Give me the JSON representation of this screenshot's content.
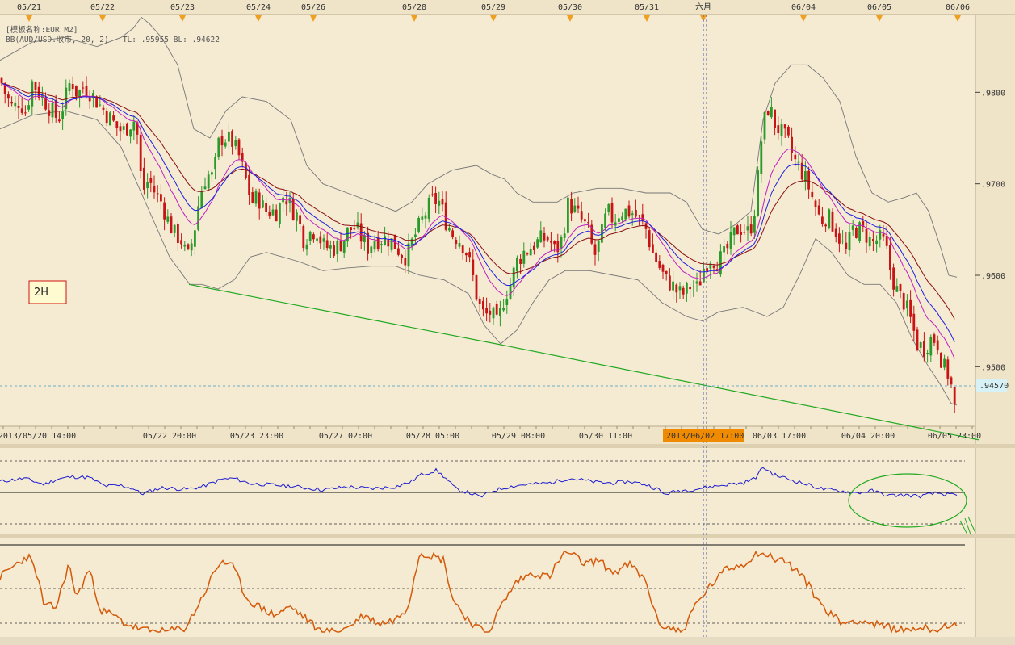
{
  "top_dates": [
    "05/21",
    "05/22",
    "05/23",
    "05/24",
    "05/26",
    "05/28",
    "05/29",
    "05/30",
    "05/31",
    "六月",
    "06/04",
    "06/05",
    "06/06"
  ],
  "info": {
    "board": "[模板名称:EUR M2]",
    "indicator": "BB(AUD/USD.收市, 20, 2) -  TL: .95955  BL: .94622"
  },
  "timeframe_label": "2H",
  "bottom_dates": [
    "2013/05/20 14:00",
    "05/22 20:00",
    "05/23 23:00",
    "05/27 02:00",
    "05/28 05:00",
    "05/29 08:00",
    "05/30 11:00",
    "2013/06/02 17:00",
    "06/03 17:00",
    "06/04 20:00",
    "06/05 23:00"
  ],
  "highlight_date": "2013/06/02 17:00",
  "current_price_label": ".94570",
  "chart_data": {
    "type": "candlestick",
    "symbol": "AUD/USD",
    "interval": "2H",
    "price_axis": {
      "ticks": [
        ".9800",
        ".9700",
        ".9600",
        ".9500"
      ],
      "values": [
        0.98,
        0.97,
        0.96,
        0.95
      ],
      "ylim": [
        0.9435,
        0.9885
      ]
    },
    "current_price": 0.9457,
    "bollinger": {
      "period": 20,
      "stddev": 2,
      "upper_last": 0.95955,
      "lower_last": 0.94622
    },
    "close_path": [
      [
        0,
        0.9815
      ],
      [
        8,
        0.9795
      ],
      [
        16,
        0.9782
      ],
      [
        24,
        0.9791
      ],
      [
        32,
        0.9778
      ],
      [
        40,
        0.9812
      ],
      [
        48,
        0.98
      ],
      [
        56,
        0.979
      ],
      [
        64,
        0.978
      ],
      [
        72,
        0.977
      ],
      [
        80,
        0.979
      ],
      [
        88,
        0.9815
      ],
      [
        96,
        0.9797
      ],
      [
        104,
        0.9807
      ],
      [
        112,
        0.98
      ],
      [
        120,
        0.979
      ],
      [
        128,
        0.9781
      ],
      [
        136,
        0.9772
      ],
      [
        144,
        0.9762
      ],
      [
        152,
        0.9757
      ],
      [
        160,
        0.9765
      ],
      [
        168,
        0.9771
      ],
      [
        172,
        0.9735
      ],
      [
        176,
        0.969
      ],
      [
        184,
        0.9705
      ],
      [
        192,
        0.969
      ],
      [
        200,
        0.968
      ],
      [
        208,
        0.966
      ],
      [
        216,
        0.9645
      ],
      [
        224,
        0.964
      ],
      [
        232,
        0.9617
      ],
      [
        240,
        0.9645
      ],
      [
        248,
        0.969
      ],
      [
        256,
        0.971
      ],
      [
        264,
        0.9707
      ],
      [
        272,
        0.975
      ],
      [
        280,
        0.975
      ],
      [
        288,
        0.9745
      ],
      [
        296,
        0.973
      ],
      [
        304,
        0.9705
      ],
      [
        312,
        0.968
      ],
      [
        320,
        0.9685
      ],
      [
        328,
        0.967
      ],
      [
        336,
        0.967
      ],
      [
        344,
        0.967
      ],
      [
        352,
        0.969
      ],
      [
        360,
        0.9675
      ],
      [
        368,
        0.9665
      ],
      [
        376,
        0.964
      ],
      [
        384,
        0.9647
      ],
      [
        392,
        0.965
      ],
      [
        400,
        0.9632
      ],
      [
        408,
        0.963
      ],
      [
        416,
        0.963
      ],
      [
        424,
        0.9637
      ],
      [
        432,
        0.965
      ],
      [
        440,
        0.9652
      ],
      [
        448,
        0.964
      ],
      [
        456,
        0.963
      ],
      [
        464,
        0.964
      ],
      [
        472,
        0.964
      ],
      [
        480,
        0.964
      ],
      [
        488,
        0.9635
      ],
      [
        496,
        0.9625
      ],
      [
        504,
        0.962
      ],
      [
        512,
        0.964
      ],
      [
        520,
        0.9655
      ],
      [
        528,
        0.967
      ],
      [
        536,
        0.9682
      ],
      [
        544,
        0.968
      ],
      [
        552,
        0.966
      ],
      [
        560,
        0.9645
      ],
      [
        568,
        0.964
      ],
      [
        576,
        0.963
      ],
      [
        584,
        0.9605
      ],
      [
        592,
        0.957
      ],
      [
        600,
        0.9555
      ],
      [
        608,
        0.956
      ],
      [
        616,
        0.9545
      ],
      [
        624,
        0.9575
      ],
      [
        632,
        0.959
      ],
      [
        640,
        0.9615
      ],
      [
        648,
        0.9625
      ],
      [
        656,
        0.963
      ],
      [
        664,
        0.9635
      ],
      [
        672,
        0.964
      ],
      [
        680,
        0.964
      ],
      [
        688,
        0.9625
      ],
      [
        696,
        0.964
      ],
      [
        704,
        0.968
      ],
      [
        712,
        0.967
      ],
      [
        720,
        0.966
      ],
      [
        728,
        0.965
      ],
      [
        736,
        0.962
      ],
      [
        744,
        0.964
      ],
      [
        752,
        0.967
      ],
      [
        760,
        0.966
      ],
      [
        768,
        0.967
      ],
      [
        776,
        0.967
      ],
      [
        784,
        0.9668
      ],
      [
        792,
        0.966
      ],
      [
        800,
        0.965
      ],
      [
        808,
        0.9625
      ],
      [
        816,
        0.961
      ],
      [
        824,
        0.9595
      ],
      [
        832,
        0.959
      ],
      [
        840,
        0.958
      ],
      [
        848,
        0.958
      ],
      [
        856,
        0.959
      ],
      [
        864,
        0.9585
      ],
      [
        872,
        0.961
      ],
      [
        880,
        0.962
      ],
      [
        888,
        0.9615
      ],
      [
        896,
        0.962
      ],
      [
        904,
        0.9635
      ],
      [
        912,
        0.965
      ],
      [
        920,
        0.9652
      ],
      [
        928,
        0.9645
      ],
      [
        936,
        0.968
      ],
      [
        944,
        0.976
      ],
      [
        952,
        0.9785
      ],
      [
        960,
        0.9765
      ],
      [
        968,
        0.9755
      ],
      [
        976,
        0.9745
      ],
      [
        984,
        0.9725
      ],
      [
        992,
        0.9715
      ],
      [
        1000,
        0.97
      ],
      [
        1008,
        0.968
      ],
      [
        1016,
        0.966
      ],
      [
        1024,
        0.9665
      ],
      [
        1032,
        0.9655
      ],
      [
        1040,
        0.964
      ],
      [
        1048,
        0.9625
      ],
      [
        1056,
        0.965
      ],
      [
        1064,
        0.965
      ],
      [
        1072,
        0.9645
      ],
      [
        1080,
        0.9635
      ],
      [
        1088,
        0.964
      ],
      [
        1096,
        0.9635
      ],
      [
        1104,
        0.96
      ],
      [
        1112,
        0.958
      ],
      [
        1120,
        0.957
      ],
      [
        1128,
        0.955
      ],
      [
        1136,
        0.9525
      ],
      [
        1144,
        0.952
      ],
      [
        1152,
        0.953
      ],
      [
        1160,
        0.953
      ],
      [
        1168,
        0.95
      ],
      [
        1176,
        0.949
      ],
      [
        1182,
        0.9455
      ]
    ],
    "bb_upper_path": [
      [
        0,
        0.9835
      ],
      [
        40,
        0.9855
      ],
      [
        80,
        0.986
      ],
      [
        120,
        0.985
      ],
      [
        150,
        0.986
      ],
      [
        165,
        0.987
      ],
      [
        175,
        0.9882
      ],
      [
        185,
        0.9875
      ],
      [
        200,
        0.986
      ],
      [
        220,
        0.983
      ],
      [
        240,
        0.976
      ],
      [
        260,
        0.975
      ],
      [
        280,
        0.978
      ],
      [
        300,
        0.9795
      ],
      [
        330,
        0.979
      ],
      [
        360,
        0.977
      ],
      [
        380,
        0.972
      ],
      [
        400,
        0.97
      ],
      [
        430,
        0.969
      ],
      [
        460,
        0.968
      ],
      [
        490,
        0.967
      ],
      [
        510,
        0.968
      ],
      [
        530,
        0.97
      ],
      [
        560,
        0.9715
      ],
      [
        590,
        0.972
      ],
      [
        610,
        0.971
      ],
      [
        625,
        0.9705
      ],
      [
        640,
        0.969
      ],
      [
        660,
        0.968
      ],
      [
        690,
        0.968
      ],
      [
        710,
        0.969
      ],
      [
        740,
        0.9695
      ],
      [
        770,
        0.9695
      ],
      [
        800,
        0.969
      ],
      [
        830,
        0.969
      ],
      [
        850,
        0.968
      ],
      [
        870,
        0.965
      ],
      [
        890,
        0.9645
      ],
      [
        910,
        0.9655
      ],
      [
        930,
        0.967
      ],
      [
        945,
        0.977
      ],
      [
        960,
        0.981
      ],
      [
        980,
        0.983
      ],
      [
        1000,
        0.983
      ],
      [
        1020,
        0.9815
      ],
      [
        1040,
        0.979
      ],
      [
        1060,
        0.973
      ],
      [
        1080,
        0.969
      ],
      [
        1100,
        0.968
      ],
      [
        1120,
        0.9685
      ],
      [
        1135,
        0.969
      ],
      [
        1150,
        0.967
      ],
      [
        1165,
        0.963
      ],
      [
        1175,
        0.96
      ],
      [
        1185,
        0.9598
      ]
    ],
    "bb_lower_path": [
      [
        0,
        0.976
      ],
      [
        40,
        0.9775
      ],
      [
        80,
        0.978
      ],
      [
        120,
        0.977
      ],
      [
        150,
        0.974
      ],
      [
        170,
        0.97
      ],
      [
        190,
        0.966
      ],
      [
        210,
        0.962
      ],
      [
        235,
        0.959
      ],
      [
        250,
        0.959
      ],
      [
        270,
        0.9585
      ],
      [
        290,
        0.9595
      ],
      [
        310,
        0.962
      ],
      [
        330,
        0.9625
      ],
      [
        350,
        0.962
      ],
      [
        370,
        0.9615
      ],
      [
        400,
        0.9605
      ],
      [
        430,
        0.9608
      ],
      [
        460,
        0.961
      ],
      [
        490,
        0.961
      ],
      [
        520,
        0.96
      ],
      [
        550,
        0.9595
      ],
      [
        580,
        0.958
      ],
      [
        600,
        0.9545
      ],
      [
        620,
        0.9525
      ],
      [
        640,
        0.954
      ],
      [
        660,
        0.957
      ],
      [
        680,
        0.9595
      ],
      [
        700,
        0.9605
      ],
      [
        730,
        0.9605
      ],
      [
        760,
        0.96
      ],
      [
        790,
        0.9595
      ],
      [
        820,
        0.957
      ],
      [
        850,
        0.9555
      ],
      [
        870,
        0.955
      ],
      [
        890,
        0.956
      ],
      [
        920,
        0.9565
      ],
      [
        950,
        0.9555
      ],
      [
        970,
        0.9565
      ],
      [
        990,
        0.96
      ],
      [
        1010,
        0.964
      ],
      [
        1030,
        0.9625
      ],
      [
        1050,
        0.96
      ],
      [
        1070,
        0.959
      ],
      [
        1090,
        0.959
      ],
      [
        1110,
        0.957
      ],
      [
        1130,
        0.953
      ],
      [
        1150,
        0.95
      ],
      [
        1165,
        0.948
      ],
      [
        1178,
        0.946
      ],
      [
        1185,
        0.9458
      ]
    ],
    "trendline": [
      [
        234,
        0.959
      ],
      [
        615,
        0.9525
      ],
      [
        1213,
        0.942
      ]
    ],
    "rsi_path": [
      [
        0,
        0.35
      ],
      [
        30,
        0.45
      ],
      [
        55,
        0.25
      ],
      [
        70,
        0.42
      ],
      [
        90,
        0.5
      ],
      [
        110,
        0.48
      ],
      [
        130,
        0.2
      ],
      [
        150,
        0.22
      ],
      [
        165,
        0.12
      ],
      [
        175,
        -0.05
      ],
      [
        200,
        0.15
      ],
      [
        230,
        0.1
      ],
      [
        250,
        0.18
      ],
      [
        275,
        0.42
      ],
      [
        290,
        0.45
      ],
      [
        310,
        0.28
      ],
      [
        330,
        0.25
      ],
      [
        360,
        0.2
      ],
      [
        400,
        0.08
      ],
      [
        430,
        0.18
      ],
      [
        460,
        0.12
      ],
      [
        490,
        0.18
      ],
      [
        510,
        0.35
      ],
      [
        520,
        0.55
      ],
      [
        540,
        0.7
      ],
      [
        550,
        0.5
      ],
      [
        565,
        0.1
      ],
      [
        580,
        0.0
      ],
      [
        595,
        -0.15
      ],
      [
        610,
        0.05
      ],
      [
        630,
        0.18
      ],
      [
        650,
        0.25
      ],
      [
        680,
        0.3
      ],
      [
        705,
        0.45
      ],
      [
        720,
        0.4
      ],
      [
        740,
        0.32
      ],
      [
        760,
        0.3
      ],
      [
        780,
        0.35
      ],
      [
        800,
        0.25
      ],
      [
        815,
        0.1
      ],
      [
        822,
        -0.06
      ],
      [
        840,
        0.05
      ],
      [
        860,
        0.1
      ],
      [
        880,
        0.18
      ],
      [
        900,
        0.25
      ],
      [
        920,
        0.3
      ],
      [
        935,
        0.45
      ],
      [
        945,
        0.8
      ],
      [
        960,
        0.55
      ],
      [
        980,
        0.4
      ],
      [
        1000,
        0.25
      ],
      [
        1020,
        0.1
      ],
      [
        1040,
        0.05
      ],
      [
        1060,
        -0.02
      ],
      [
        1080,
        0.05
      ],
      [
        1100,
        -0.1
      ],
      [
        1120,
        -0.08
      ],
      [
        1140,
        -0.12
      ],
      [
        1160,
        -0.02
      ],
      [
        1175,
        -0.08
      ],
      [
        1185,
        -0.1
      ]
    ],
    "stoch_path": [
      [
        0,
        0.65
      ],
      [
        20,
        0.8
      ],
      [
        35,
        0.9
      ],
      [
        45,
        0.7
      ],
      [
        55,
        0.3
      ],
      [
        70,
        0.3
      ],
      [
        85,
        0.8
      ],
      [
        95,
        0.4
      ],
      [
        110,
        0.75
      ],
      [
        125,
        0.25
      ],
      [
        140,
        0.2
      ],
      [
        155,
        0.1
      ],
      [
        170,
        0.05
      ],
      [
        180,
        0.02
      ],
      [
        200,
        0.0
      ],
      [
        215,
        0.02
      ],
      [
        230,
        0.05
      ],
      [
        250,
        0.4
      ],
      [
        265,
        0.7
      ],
      [
        275,
        0.85
      ],
      [
        290,
        0.75
      ],
      [
        305,
        0.4
      ],
      [
        320,
        0.3
      ],
      [
        340,
        0.2
      ],
      [
        360,
        0.3
      ],
      [
        380,
        0.15
      ],
      [
        395,
        0.02
      ],
      [
        410,
        0.0
      ],
      [
        430,
        0.05
      ],
      [
        450,
        0.2
      ],
      [
        470,
        0.1
      ],
      [
        490,
        0.15
      ],
      [
        505,
        0.3
      ],
      [
        520,
        0.95
      ],
      [
        535,
        0.9
      ],
      [
        550,
        0.85
      ],
      [
        560,
        0.4
      ],
      [
        575,
        0.2
      ],
      [
        590,
        0.05
      ],
      [
        605,
        0.0
      ],
      [
        620,
        0.3
      ],
      [
        640,
        0.6
      ],
      [
        660,
        0.7
      ],
      [
        680,
        0.65
      ],
      [
        700,
        0.95
      ],
      [
        710,
        0.9
      ],
      [
        725,
        0.8
      ],
      [
        740,
        0.85
      ],
      [
        760,
        0.7
      ],
      [
        780,
        0.8
      ],
      [
        800,
        0.6
      ],
      [
        815,
        0.1
      ],
      [
        830,
        0.05
      ],
      [
        845,
        0.0
      ],
      [
        860,
        0.3
      ],
      [
        880,
        0.55
      ],
      [
        900,
        0.75
      ],
      [
        920,
        0.8
      ],
      [
        940,
        0.95
      ],
      [
        955,
        0.88
      ],
      [
        970,
        0.85
      ],
      [
        990,
        0.7
      ],
      [
        1005,
        0.5
      ],
      [
        1015,
        0.35
      ],
      [
        1030,
        0.2
      ],
      [
        1045,
        0.1
      ],
      [
        1060,
        0.15
      ],
      [
        1080,
        0.1
      ],
      [
        1100,
        0.05
      ],
      [
        1120,
        0.02
      ],
      [
        1140,
        0.06
      ],
      [
        1160,
        0.02
      ],
      [
        1175,
        0.1
      ],
      [
        1185,
        0.05
      ]
    ]
  },
  "colors": {
    "background": "#f5ead2",
    "up": "#2a9a2a",
    "down": "#c81414",
    "ma_fast": "#2020e0",
    "ma_mid": "#c020c0",
    "ma_slow": "#8a1010",
    "bb": "#777777",
    "trendline": "#22aa22",
    "rsi": "#1a1ad0",
    "stoch": "#d45a0a",
    "highlight_fill": "#f08a00",
    "price_label_bg": "#d7f2f7"
  }
}
